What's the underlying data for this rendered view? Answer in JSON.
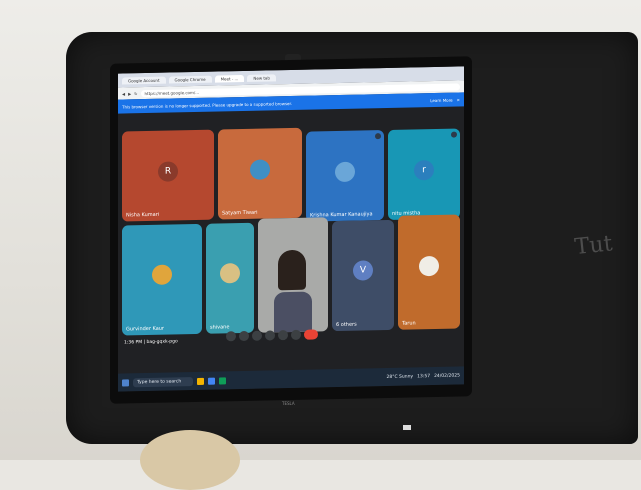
{
  "browser": {
    "tabs": [
      "Google Account",
      "Google Chrome",
      "Meet - ...",
      "New tab"
    ],
    "url": "https://meet.google.com/..."
  },
  "banner": {
    "message": "This browser version is no longer supported. Please upgrade to a supported browser.",
    "learn_more": "Learn More"
  },
  "participants": [
    {
      "name": "Nisha Kumari",
      "initial": "R",
      "color": "#b5482f"
    },
    {
      "name": "Satyam Tiwari",
      "initial": "",
      "color": "#c86a3d"
    },
    {
      "name": "Krishna Kumar Kanaujiya",
      "initial": "",
      "color": "#2d73c2"
    },
    {
      "name": "nitu mistha",
      "initial": "r",
      "color": "#1897b5"
    },
    {
      "name": "Gurvinder Kaur",
      "initial": "",
      "color": "#2f98b8"
    },
    {
      "name": "shivane",
      "initial": "",
      "color": "#3a9fb0"
    },
    {
      "name": "",
      "initial": "",
      "color": "#a9aaa8"
    },
    {
      "name": "6 others",
      "initial": "V",
      "color": "#3e4d67"
    },
    {
      "name": "Tarun",
      "initial": "",
      "color": "#c06b2c"
    }
  ],
  "bottom_left": {
    "time": "1:36 PM",
    "meeting_code": "bag-gqxk-pgo"
  },
  "taskbar": {
    "search_placeholder": "Type here to search",
    "weather": "28°C Sunny",
    "clock_time": "13:57",
    "clock_date": "24/02/2025"
  },
  "monitor_brand": "TESLA",
  "board_text": "Tut"
}
